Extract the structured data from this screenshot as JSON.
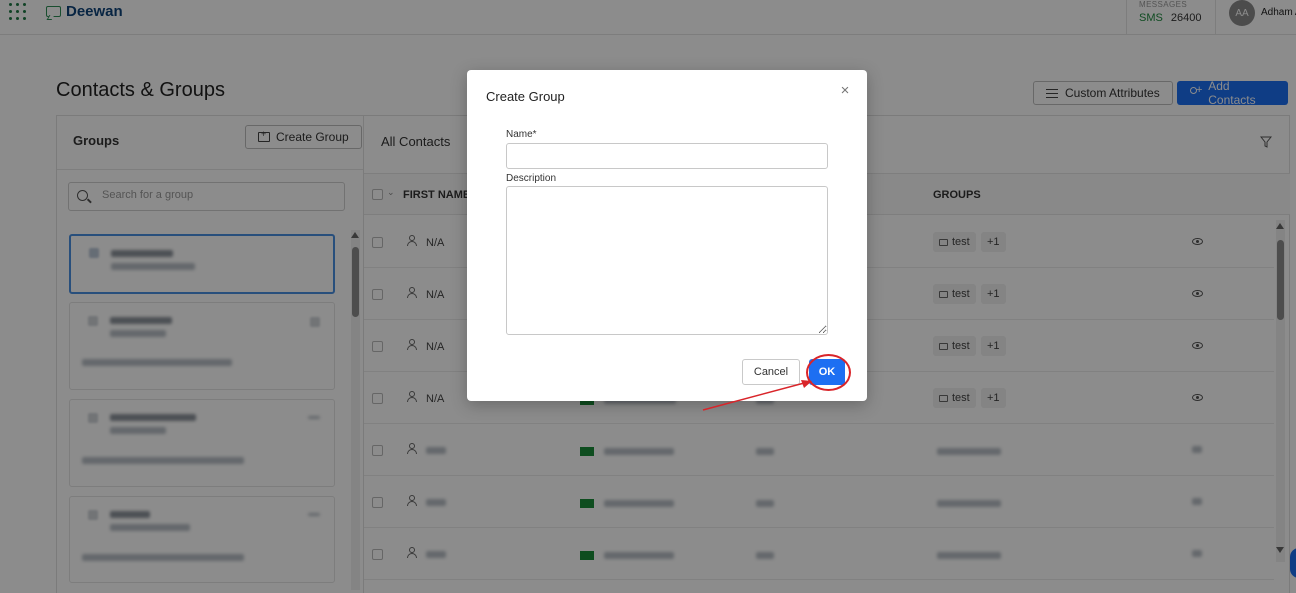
{
  "app": {
    "brand": "Deewan",
    "messages_title": "MESSAGES",
    "messages_channel": "SMS",
    "messages_count": "26400",
    "avatar_initials": "AA",
    "user_name": "Adham A"
  },
  "page": {
    "title": "Contacts & Groups",
    "custom_attributes_label": "Custom Attributes",
    "add_contacts_label": "Add Contacts"
  },
  "groups": {
    "title": "Groups",
    "create_group_label": "Create Group",
    "search_placeholder": "Search for a group"
  },
  "contacts": {
    "title": "All Contacts",
    "columns": [
      "FIRST NAME",
      "GROUPS"
    ],
    "rows": [
      {
        "first_name": "N/A",
        "group_tag": "test",
        "extra_groups": "+1"
      },
      {
        "first_name": "N/A",
        "group_tag": "test",
        "extra_groups": "+1"
      },
      {
        "first_name": "N/A",
        "group_tag": "test",
        "extra_groups": "+1"
      },
      {
        "first_name": "N/A",
        "group_tag": "test",
        "extra_groups": "+1"
      }
    ]
  },
  "modal": {
    "title": "Create Group",
    "close_glyph": "×",
    "name_label": "Name*",
    "name_value": "",
    "description_label": "Description",
    "description_value": "",
    "cancel_label": "Cancel",
    "ok_label": "OK"
  },
  "colors": {
    "primary": "#1d6ff2",
    "brand_green": "#1e8a3f",
    "annotation_red": "#d9252a"
  }
}
